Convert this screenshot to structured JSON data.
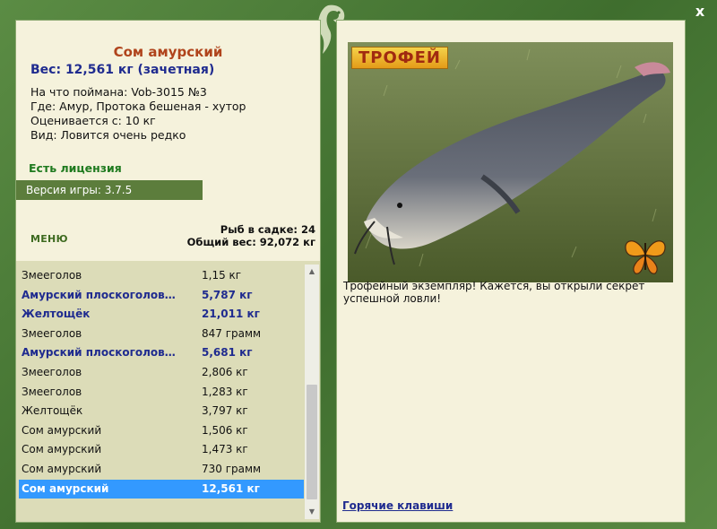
{
  "window": {
    "close_glyph": "x"
  },
  "fish": {
    "title": "Сом амурский",
    "weight": "Вес: 12,561 кг (зачетная)",
    "info": [
      "На что поймана: Vob-3015 №3",
      "Где: Амур, Протока бешеная - хутор",
      "Оценивается с: 10 кг",
      "Вид: Ловится очень редко"
    ],
    "license": "Есть лицензия"
  },
  "version": "Версия игры: 3.7.5",
  "menu_label": "МЕНЮ",
  "stats": {
    "fish_count": "Рыб в садке: 24",
    "total_weight": "Общий вес: 92,072 кг"
  },
  "catch_list": [
    {
      "name": "Змееголов",
      "weight": "1,15 кг",
      "style": "normal"
    },
    {
      "name": "Амурский плоскоголов…",
      "weight": "5,787 кг",
      "style": "bold"
    },
    {
      "name": "Желтощёк",
      "weight": "21,011 кг",
      "style": "bold"
    },
    {
      "name": "Змееголов",
      "weight": "847 грамм",
      "style": "normal"
    },
    {
      "name": "Амурский плоскоголов…",
      "weight": "5,681 кг",
      "style": "bold"
    },
    {
      "name": "Змееголов",
      "weight": "2,806 кг",
      "style": "normal"
    },
    {
      "name": "Змееголов",
      "weight": "1,283 кг",
      "style": "normal"
    },
    {
      "name": "Желтощёк",
      "weight": "3,797 кг",
      "style": "normal"
    },
    {
      "name": "Сом амурский",
      "weight": "1,506 кг",
      "style": "normal"
    },
    {
      "name": "Сом амурский",
      "weight": "1,473 кг",
      "style": "normal"
    },
    {
      "name": "Сом амурский",
      "weight": "730 грамм",
      "style": "normal"
    },
    {
      "name": "Сом амурский",
      "weight": "12,561 кг",
      "style": "selected"
    }
  ],
  "trophy_label": "ТРОФЕЙ",
  "description": "Трофейный экземпляр! Кажется, вы открыли секрет успешной ловли!",
  "hotkeys_label": "Горячие клавиши",
  "icons": {
    "close": "close-icon",
    "emblem": "fish-emblem-icon",
    "butterfly": "butterfly-icon"
  }
}
